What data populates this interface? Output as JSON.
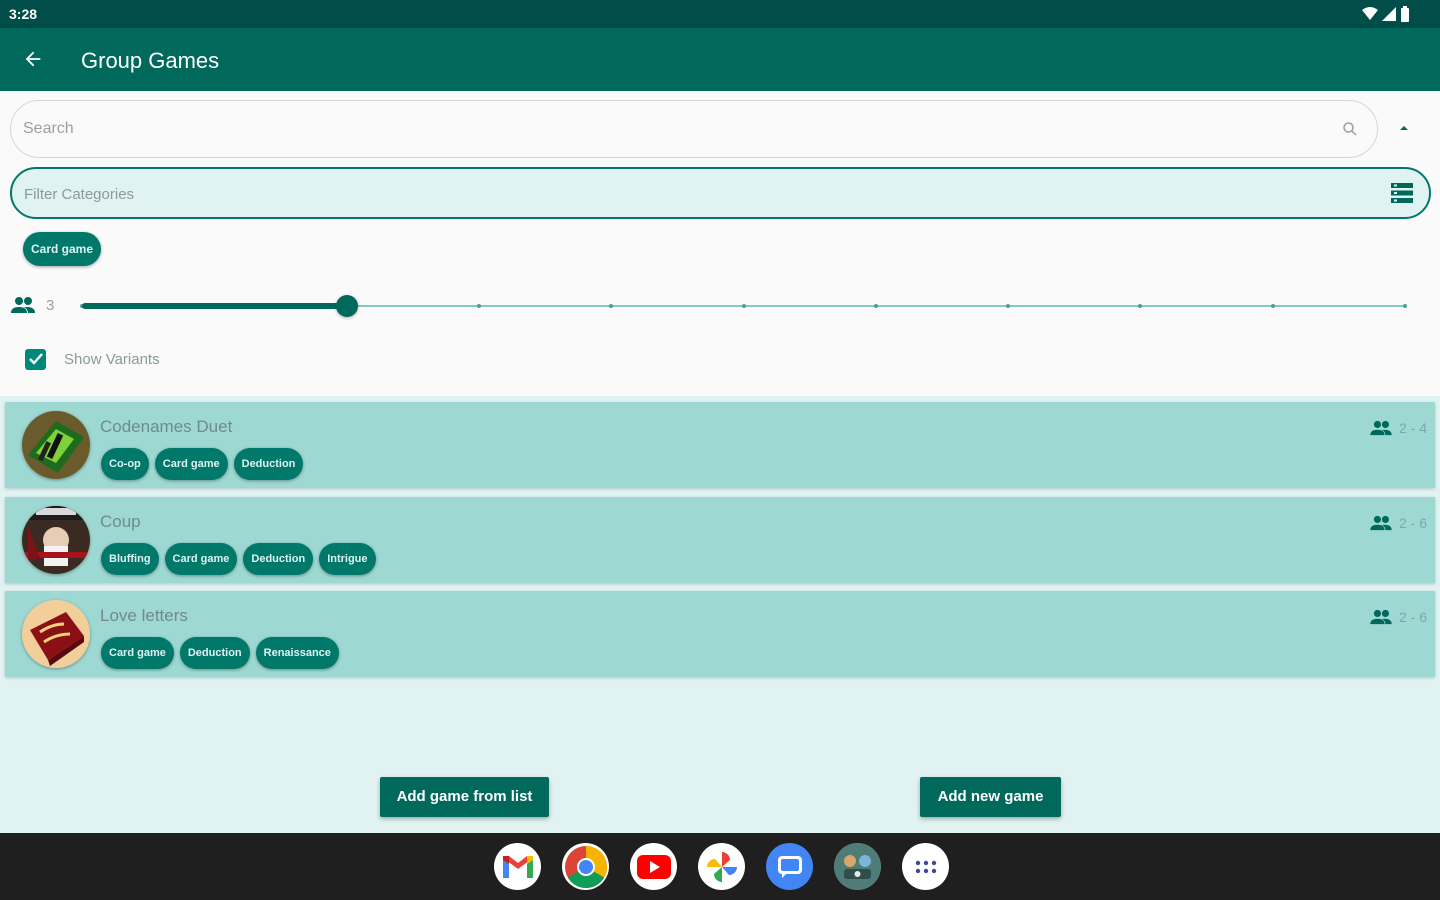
{
  "status_bar": {
    "time": "3:28"
  },
  "app_bar": {
    "title": "Group Games"
  },
  "search": {
    "placeholder": "Search"
  },
  "filter": {
    "label": "Filter Categories"
  },
  "selected_categories": [
    "Card game"
  ],
  "players_filter": {
    "value": "3",
    "min": 1,
    "max": 11,
    "current": 3
  },
  "variants": {
    "label": "Show Variants",
    "checked": true
  },
  "games": [
    {
      "name": "Codenames Duet",
      "tags": [
        "Co-op",
        "Card game",
        "Deduction"
      ],
      "players": "2 - 4"
    },
    {
      "name": "Coup",
      "tags": [
        "Bluffing",
        "Card game",
        "Deduction",
        "Intrigue"
      ],
      "players": "2 - 6"
    },
    {
      "name": "Love letters",
      "tags": [
        "Card game",
        "Deduction",
        "Renaissance"
      ],
      "players": "2 - 6"
    }
  ],
  "buttons": {
    "add_from_list": "Add game from list",
    "add_new": "Add new game"
  },
  "dock_apps": [
    "gmail-icon",
    "chrome-icon",
    "youtube-icon",
    "photos-icon",
    "messages-icon",
    "group-games-app-icon",
    "app-drawer-icon"
  ],
  "colors": {
    "primary": "#00695c",
    "primary_dark": "#004d4a",
    "card": "#9ed8d2",
    "background": "#e0f2f1"
  }
}
